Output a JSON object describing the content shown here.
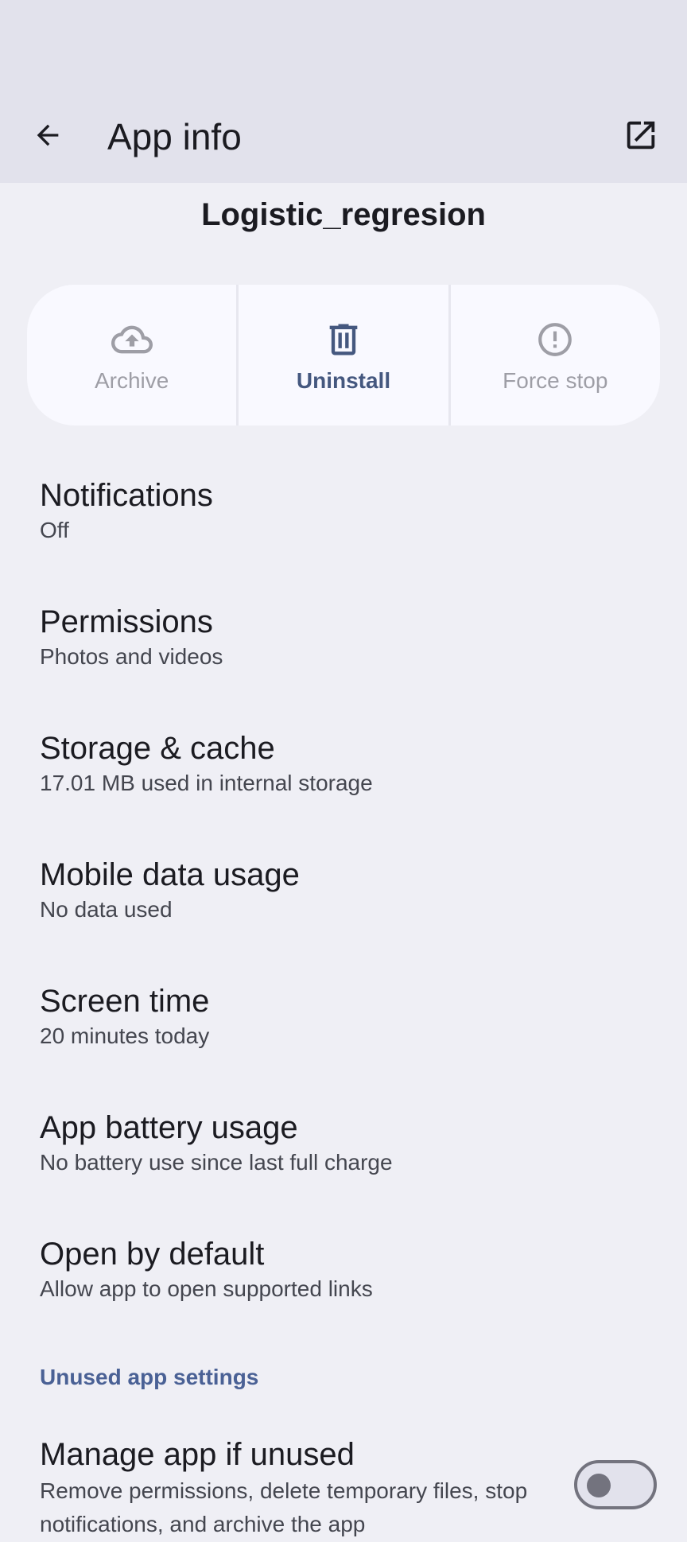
{
  "header": {
    "title": "App info",
    "back_icon": "arrow-back-icon",
    "open_icon": "open-in-new-icon"
  },
  "app": {
    "name": "Logistic_regresion"
  },
  "actions": [
    {
      "label": "Archive",
      "icon": "cloud-upload-icon",
      "state": "disabled"
    },
    {
      "label": "Uninstall",
      "icon": "trash-icon",
      "state": "enabled"
    },
    {
      "label": "Force stop",
      "icon": "alert-circle-icon",
      "state": "disabled"
    }
  ],
  "items": [
    {
      "title": "Notifications",
      "subtitle": "Off"
    },
    {
      "title": "Permissions",
      "subtitle": "Photos and videos"
    },
    {
      "title": "Storage & cache",
      "subtitle": "17.01 MB used in internal storage"
    },
    {
      "title": "Mobile data usage",
      "subtitle": "No data used"
    },
    {
      "title": "Screen time",
      "subtitle": "20 minutes today"
    },
    {
      "title": "App battery usage",
      "subtitle": "No battery use since last full charge"
    },
    {
      "title": "Open by default",
      "subtitle": "Allow app to open supported links"
    }
  ],
  "unused_section": {
    "header": "Unused app settings",
    "manage_title": "Manage app if unused",
    "manage_subtitle": "Remove permissions, delete temporary files, stop notifications, and archive the app",
    "toggle_on": false
  },
  "colors": {
    "accent": "#45587f",
    "section_header": "#4a6195",
    "background": "#efeff5",
    "app_bar": "#e2e2ec"
  }
}
